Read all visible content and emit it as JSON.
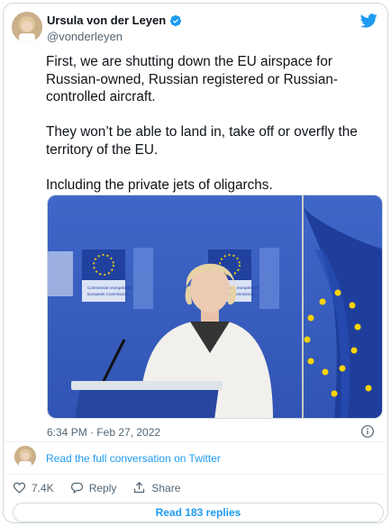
{
  "author": {
    "name": "Ursula von der Leyen",
    "handle": "@vonderleyen"
  },
  "tweet": {
    "paragraphs": [
      "First, we are shutting down the EU airspace for Russian-owned, Russian registered or Russian-controlled aircraft.",
      "They won’t be able to land in, take off or overfly the territory of the EU.",
      "Including the private jets of oligarchs."
    ],
    "timestamp": "6:34 PM · Feb 27, 2022"
  },
  "media": {
    "backdrop_text_1": "Commission européenne",
    "backdrop_text_2": "European Commission"
  },
  "conversation": {
    "link_label": "Read the full conversation on Twitter"
  },
  "actions": {
    "likes": "7.4K",
    "reply_label": "Reply",
    "share_label": "Share"
  },
  "read_replies_label": "Read 183 replies",
  "colors": {
    "accent": "#1d9bf0",
    "text_secondary": "#536471",
    "eu_blue": "#1f3e9c",
    "eu_gold": "#ffd400"
  },
  "icons": [
    "verified-badge-icon",
    "twitter-logo-icon",
    "info-icon",
    "heart-icon",
    "reply-icon",
    "share-icon"
  ]
}
